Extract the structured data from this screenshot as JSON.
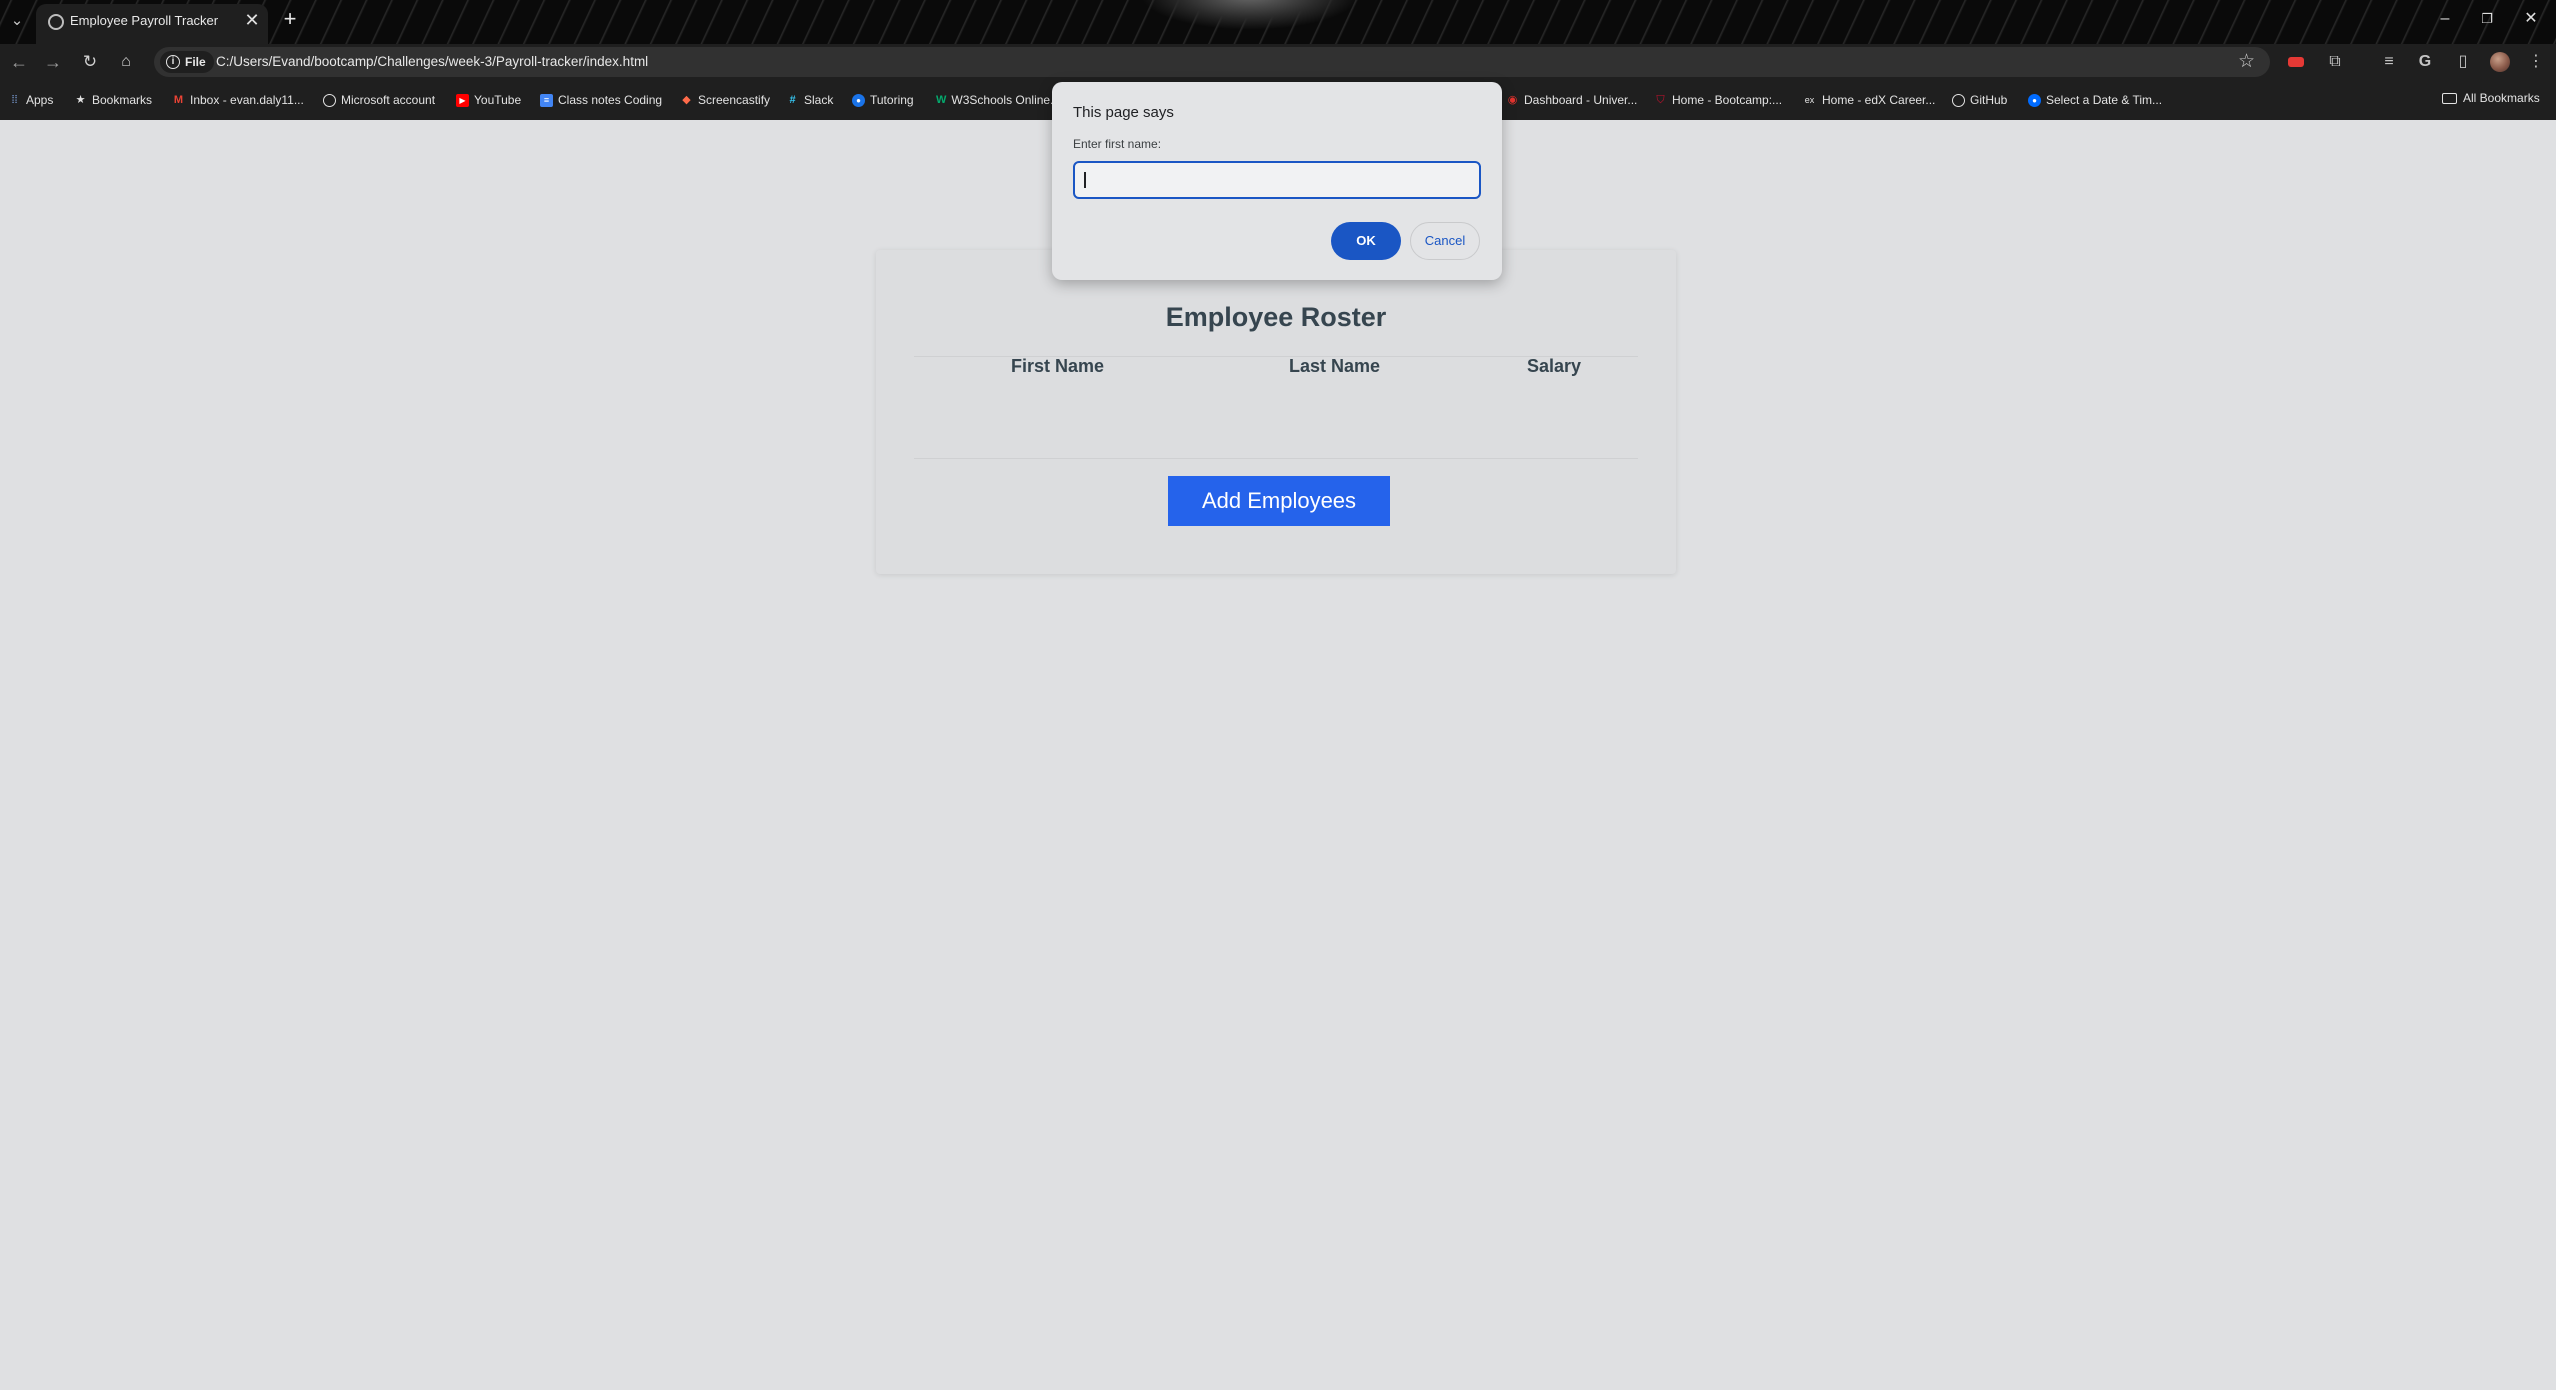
{
  "browser": {
    "tab": {
      "title": "Employee Payroll Tracker",
      "close_glyph": "✕"
    },
    "new_tab_glyph": "+",
    "address": {
      "chip_label": "File",
      "url": "C:/Users/Evand/bootcamp/Challenges/week-3/Payroll-tracker/index.html"
    },
    "bookmarks": [
      {
        "label": "Apps",
        "icon": "apps-grid-icon"
      },
      {
        "label": "Bookmarks",
        "icon": "star-icon"
      },
      {
        "label": "Inbox - evan.daly11...",
        "icon": "gmail-icon"
      },
      {
        "label": "Microsoft account",
        "icon": "globe-icon"
      },
      {
        "label": "YouTube",
        "icon": "youtube-icon"
      },
      {
        "label": "Class notes Coding",
        "icon": "docs-icon"
      },
      {
        "label": "Screencastify",
        "icon": "screencastify-icon"
      },
      {
        "label": "Slack",
        "icon": "slack-icon"
      },
      {
        "label": "Tutoring",
        "icon": "tutoring-icon"
      },
      {
        "label": "W3Schools Online...",
        "icon": "w3schools-icon"
      },
      {
        "label": "Dashboard - Univer...",
        "icon": "canvas-icon"
      },
      {
        "label": "Home - Bootcamp:...",
        "icon": "shield-icon"
      },
      {
        "label": "Home - edX Career...",
        "icon": "edx-icon"
      },
      {
        "label": "GitHub",
        "icon": "github-icon"
      },
      {
        "label": "Select a Date & Tim...",
        "icon": "calendly-icon"
      }
    ],
    "all_bookmarks_label": "All Bookmarks"
  },
  "page": {
    "title": "Employee Roster",
    "columns": [
      "First Name",
      "Last Name",
      "Salary"
    ],
    "rows": [],
    "add_button_label": "Add Employees"
  },
  "dialog": {
    "title": "This page says",
    "message": "Enter first name:",
    "input_value": "",
    "ok_label": "OK",
    "cancel_label": "Cancel"
  },
  "colors": {
    "page_background": "#dfe0e2",
    "heading_text": "#36454f",
    "primary_button": "#2563eb",
    "dialog_accent": "#1a56c4"
  }
}
